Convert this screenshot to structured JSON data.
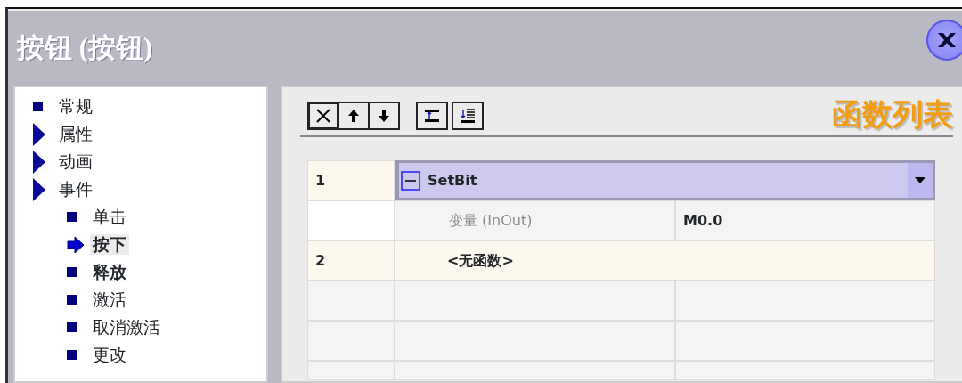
{
  "window": {
    "title": "按钮 (按钮)"
  },
  "tree": [
    {
      "label": "常规",
      "kind": "leaf",
      "selected": false,
      "configured": false
    },
    {
      "label": "属性",
      "kind": "group",
      "selected": false,
      "configured": false
    },
    {
      "label": "动画",
      "kind": "group",
      "selected": false,
      "configured": false
    },
    {
      "label": "事件",
      "kind": "group",
      "selected": false,
      "configured": false,
      "children": [
        {
          "label": "单击",
          "kind": "leaf",
          "selected": false,
          "configured": false
        },
        {
          "label": "按下",
          "kind": "leaf",
          "selected": true,
          "configured": true
        },
        {
          "label": "释放",
          "kind": "leaf",
          "selected": false,
          "configured": true
        },
        {
          "label": "激活",
          "kind": "leaf",
          "selected": false,
          "configured": false
        },
        {
          "label": "取消激活",
          "kind": "leaf",
          "selected": false,
          "configured": false
        },
        {
          "label": "更改",
          "kind": "leaf",
          "selected": false,
          "configured": false
        }
      ]
    }
  ],
  "toolbar": [
    {
      "kind": "delete",
      "pressed": true
    },
    {
      "kind": "up",
      "pressed": false
    },
    {
      "kind": "down",
      "pressed": false
    },
    {
      "kind": "indent",
      "pressed": false
    },
    {
      "kind": "list",
      "pressed": false
    }
  ],
  "heading": "函数列表",
  "functions": [
    {
      "number": "1",
      "name": "SetBit",
      "selected": true,
      "expanded": true,
      "params": [
        {
          "name": "变量 (InOut)",
          "value": "M0.0"
        }
      ]
    },
    {
      "number": "2",
      "name": "<无函数>",
      "selected": false
    }
  ]
}
